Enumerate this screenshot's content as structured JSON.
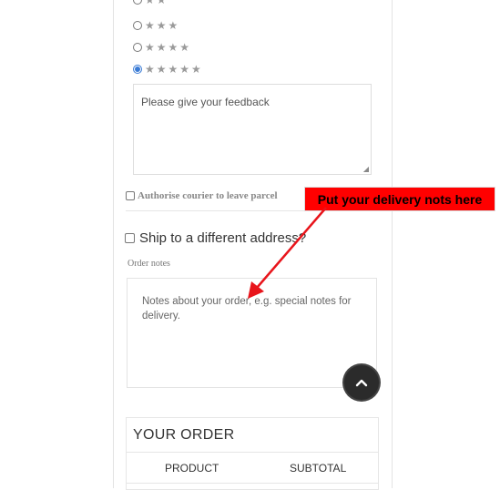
{
  "rating": {
    "options": [
      {
        "stars": "★★★",
        "checked": false
      },
      {
        "stars": "★★★★",
        "checked": false
      },
      {
        "stars": "★★★★★",
        "checked": true
      }
    ]
  },
  "feedback": {
    "placeholder": "Please give your feedback"
  },
  "courier": {
    "label": "Authorise courier to leave parcel"
  },
  "ship": {
    "label": "Ship to a different address?"
  },
  "order_notes": {
    "label": "Order notes",
    "placeholder": "Notes about your order, e.g. special notes for delivery."
  },
  "annotation": {
    "text": "Put your delivery nots here",
    "color": "#ff0000"
  },
  "your_order": {
    "title": "YOUR ORDER",
    "columns": [
      "PRODUCT",
      "SUBTOTAL"
    ]
  },
  "scroll_top": {
    "icon": "chevron-up-icon"
  }
}
